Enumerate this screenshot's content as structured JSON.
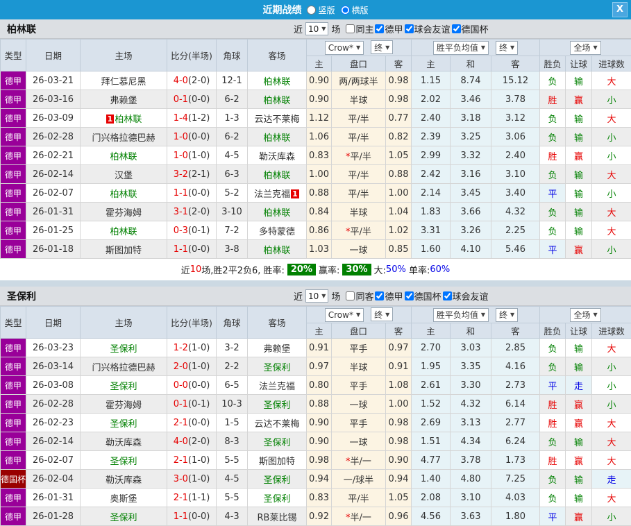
{
  "title_bar": {
    "title": "近期战绩",
    "layout_options": [
      {
        "label": "竖版",
        "selected": false
      },
      {
        "label": "横版",
        "selected": true
      }
    ],
    "close_icon": "X"
  },
  "colors": {
    "accent_blue": "#1b96d2",
    "type_league_purple": "#990099",
    "type_cup_darkred": "#990000",
    "self_team_green": "#008000",
    "score_red": "#e60000",
    "draw_blue": "#0000e6",
    "rate_badge_green": "#008000"
  },
  "result_color_map": {
    "胜": "red",
    "平": "blue",
    "负": "green",
    "赢": "red",
    "输": "green",
    "走": "blue",
    "大": "red",
    "小": "green"
  },
  "table_headers": {
    "left": [
      "类型",
      "日期",
      "主场",
      "比分(半场)",
      "角球",
      "客场"
    ],
    "sub": [
      "主",
      "盘口",
      "客",
      "主",
      "和",
      "客",
      "胜负",
      "让球",
      "进球数"
    ]
  },
  "filter_labels": {
    "near": "近",
    "unit": "场"
  },
  "tables": [
    {
      "team": "柏林联",
      "games": "10",
      "same_side_label": "同主",
      "same_side_checked": false,
      "league_filters": [
        {
          "label": "德甲",
          "checked": true
        },
        {
          "label": "球会友谊",
          "checked": true
        },
        {
          "label": "德国杯",
          "checked": true
        }
      ],
      "selects": {
        "company": "Crow*",
        "company_stage": "终",
        "avg": "胜平负均值",
        "avg_stage": "终",
        "scope": "全场"
      },
      "rows": [
        {
          "type": "德甲",
          "date": "26-03-21",
          "home": "拜仁慕尼黑",
          "score": "4-0",
          "half": "(2-0)",
          "corner": "12-1",
          "away": "柏林联",
          "away_self": true,
          "h": "0.90",
          "pan": "两/两球半",
          "a": "0.98",
          "o1": "1.15",
          "ox": "8.74",
          "o2": "15.12",
          "r1": "负",
          "r2": "输",
          "r3": "大"
        },
        {
          "type": "德甲",
          "date": "26-03-16",
          "home": "弗赖堡",
          "score": "0-1",
          "half": "(0-0)",
          "corner": "6-2",
          "away": "柏林联",
          "away_self": true,
          "h": "0.90",
          "pan": "半球",
          "a": "0.98",
          "o1": "2.02",
          "ox": "3.46",
          "o2": "3.78",
          "r1": "胜",
          "r2": "赢",
          "r3": "小"
        },
        {
          "type": "德甲",
          "date": "26-03-09",
          "home": "柏林联",
          "home_self": true,
          "home_badge": "1",
          "score": "1-4",
          "half": "(1-2)",
          "corner": "1-3",
          "away": "云达不莱梅",
          "h": "1.12",
          "pan": "平/半",
          "a": "0.77",
          "o1": "2.40",
          "ox": "3.18",
          "o2": "3.12",
          "r1": "负",
          "r2": "输",
          "r3": "大"
        },
        {
          "type": "德甲",
          "date": "26-02-28",
          "home": "门兴格拉德巴赫",
          "score": "1-0",
          "half": "(0-0)",
          "corner": "6-2",
          "away": "柏林联",
          "away_self": true,
          "h": "1.06",
          "pan": "平/半",
          "a": "0.82",
          "o1": "2.39",
          "ox": "3.25",
          "o2": "3.06",
          "r1": "负",
          "r2": "输",
          "r3": "小"
        },
        {
          "type": "德甲",
          "date": "26-02-21",
          "home": "柏林联",
          "home_self": true,
          "score": "1-0",
          "half": "(1-0)",
          "corner": "4-5",
          "away": "勒沃库森",
          "h": "0.83",
          "pan": "*平/半",
          "a": "1.05",
          "o1": "2.99",
          "ox": "3.32",
          "o2": "2.40",
          "r1": "胜",
          "r2": "赢",
          "r3": "小"
        },
        {
          "type": "德甲",
          "date": "26-02-14",
          "home": "汉堡",
          "score": "3-2",
          "half": "(2-1)",
          "corner": "6-3",
          "away": "柏林联",
          "away_self": true,
          "h": "1.00",
          "pan": "平/半",
          "a": "0.88",
          "o1": "2.42",
          "ox": "3.16",
          "o2": "3.10",
          "r1": "负",
          "r2": "输",
          "r3": "大"
        },
        {
          "type": "德甲",
          "date": "26-02-07",
          "home": "柏林联",
          "home_self": true,
          "score": "1-1",
          "half": "(0-0)",
          "corner": "5-2",
          "away": "法兰克福",
          "away_badge": "1",
          "h": "0.88",
          "pan": "平/半",
          "a": "1.00",
          "o1": "2.14",
          "ox": "3.45",
          "o2": "3.40",
          "r1": "平",
          "r2": "输",
          "r3": "小"
        },
        {
          "type": "德甲",
          "date": "26-01-31",
          "home": "霍芬海姆",
          "score": "3-1",
          "half": "(2-0)",
          "corner": "3-10",
          "away": "柏林联",
          "away_self": true,
          "h": "0.84",
          "pan": "半球",
          "a": "1.04",
          "o1": "1.83",
          "ox": "3.66",
          "o2": "4.32",
          "r1": "负",
          "r2": "输",
          "r3": "大"
        },
        {
          "type": "德甲",
          "date": "26-01-25",
          "home": "柏林联",
          "home_self": true,
          "score": "0-3",
          "half": "(0-1)",
          "corner": "7-2",
          "away": "多特蒙德",
          "h": "0.86",
          "pan": "*平/半",
          "a": "1.02",
          "o1": "3.31",
          "ox": "3.26",
          "o2": "2.25",
          "r1": "负",
          "r2": "输",
          "r3": "大"
        },
        {
          "type": "德甲",
          "date": "26-01-18",
          "home": "斯图加特",
          "score": "1-1",
          "half": "(0-0)",
          "corner": "3-8",
          "away": "柏林联",
          "away_self": true,
          "h": "1.03",
          "pan": "一球",
          "a": "0.85",
          "o1": "1.60",
          "ox": "4.10",
          "o2": "5.46",
          "r1": "平",
          "r2": "赢",
          "r3": "小"
        }
      ],
      "summary": {
        "prefix": "近",
        "count": "10",
        "record_text": "场,胜2平2负6, 胜率:",
        "win_rate": "20%",
        "handicap_label": "赢率:",
        "handicap_rate": "30%",
        "big_label": "大:",
        "big_rate": "50%",
        "single_label": " 单率:",
        "single_rate": "60%"
      }
    },
    {
      "team": "圣保利",
      "games": "10",
      "same_side_label": "同客",
      "same_side_checked": false,
      "league_filters": [
        {
          "label": "德甲",
          "checked": true
        },
        {
          "label": "德国杯",
          "checked": true
        },
        {
          "label": "球会友谊",
          "checked": true
        }
      ],
      "selects": {
        "company": "Crow*",
        "company_stage": "终",
        "avg": "胜平负均值",
        "avg_stage": "终",
        "scope": "全场"
      },
      "rows": [
        {
          "type": "德甲",
          "date": "26-03-23",
          "home": "圣保利",
          "home_self": true,
          "score": "1-2",
          "half": "(1-0)",
          "corner": "3-2",
          "away": "弗赖堡",
          "h": "0.91",
          "pan": "平手",
          "a": "0.97",
          "o1": "2.70",
          "ox": "3.03",
          "o2": "2.85",
          "r1": "负",
          "r2": "输",
          "r3": "大"
        },
        {
          "type": "德甲",
          "date": "26-03-14",
          "home": "门兴格拉德巴赫",
          "score": "2-0",
          "half": "(1-0)",
          "corner": "2-2",
          "away": "圣保利",
          "away_self": true,
          "h": "0.97",
          "pan": "半球",
          "a": "0.91",
          "o1": "1.95",
          "ox": "3.35",
          "o2": "4.16",
          "r1": "负",
          "r2": "输",
          "r3": "小"
        },
        {
          "type": "德甲",
          "date": "26-03-08",
          "home": "圣保利",
          "home_self": true,
          "score": "0-0",
          "half": "(0-0)",
          "corner": "6-5",
          "away": "法兰克福",
          "h": "0.80",
          "pan": "平手",
          "a": "1.08",
          "o1": "2.61",
          "ox": "3.30",
          "o2": "2.73",
          "r1": "平",
          "r2": "走",
          "r3": "小"
        },
        {
          "type": "德甲",
          "date": "26-02-28",
          "home": "霍芬海姆",
          "score": "0-1",
          "half": "(0-1)",
          "corner": "10-3",
          "away": "圣保利",
          "away_self": true,
          "h": "0.88",
          "pan": "一球",
          "a": "1.00",
          "o1": "1.52",
          "ox": "4.32",
          "o2": "6.14",
          "r1": "胜",
          "r2": "赢",
          "r3": "小"
        },
        {
          "type": "德甲",
          "date": "26-02-23",
          "home": "圣保利",
          "home_self": true,
          "score": "2-1",
          "half": "(0-0)",
          "corner": "1-5",
          "away": "云达不莱梅",
          "h": "0.90",
          "pan": "平手",
          "a": "0.98",
          "o1": "2.69",
          "ox": "3.13",
          "o2": "2.77",
          "r1": "胜",
          "r2": "赢",
          "r3": "大"
        },
        {
          "type": "德甲",
          "date": "26-02-14",
          "home": "勒沃库森",
          "score": "4-0",
          "half": "(2-0)",
          "corner": "8-3",
          "away": "圣保利",
          "away_self": true,
          "h": "0.90",
          "pan": "一球",
          "a": "0.98",
          "o1": "1.51",
          "ox": "4.34",
          "o2": "6.24",
          "r1": "负",
          "r2": "输",
          "r3": "大"
        },
        {
          "type": "德甲",
          "date": "26-02-07",
          "home": "圣保利",
          "home_self": true,
          "score": "2-1",
          "half": "(1-0)",
          "corner": "5-5",
          "away": "斯图加特",
          "h": "0.98",
          "pan": "*半/一",
          "a": "0.90",
          "o1": "4.77",
          "ox": "3.78",
          "o2": "1.73",
          "r1": "胜",
          "r2": "赢",
          "r3": "大"
        },
        {
          "type": "德国杯",
          "date": "26-02-04",
          "home": "勒沃库森",
          "score": "3-0",
          "half": "(1-0)",
          "corner": "4-5",
          "away": "圣保利",
          "away_self": true,
          "h": "0.94",
          "pan": "一/球半",
          "a": "0.94",
          "o1": "1.40",
          "ox": "4.80",
          "o2": "7.25",
          "r1": "负",
          "r2": "输",
          "r3": "走"
        },
        {
          "type": "德甲",
          "date": "26-01-31",
          "home": "奥斯堡",
          "score": "2-1",
          "half": "(1-1)",
          "corner": "5-5",
          "away": "圣保利",
          "away_self": true,
          "h": "0.83",
          "pan": "平/半",
          "a": "1.05",
          "o1": "2.08",
          "ox": "3.10",
          "o2": "4.03",
          "r1": "负",
          "r2": "输",
          "r3": "大"
        },
        {
          "type": "德甲",
          "date": "26-01-28",
          "home": "圣保利",
          "home_self": true,
          "score": "1-1",
          "half": "(0-0)",
          "corner": "4-3",
          "away": "RB莱比锡",
          "h": "0.92",
          "pan": "*半/一",
          "a": "0.96",
          "o1": "4.56",
          "ox": "3.63",
          "o2": "1.80",
          "r1": "平",
          "r2": "赢",
          "r3": "小"
        }
      ],
      "summary": null
    }
  ]
}
